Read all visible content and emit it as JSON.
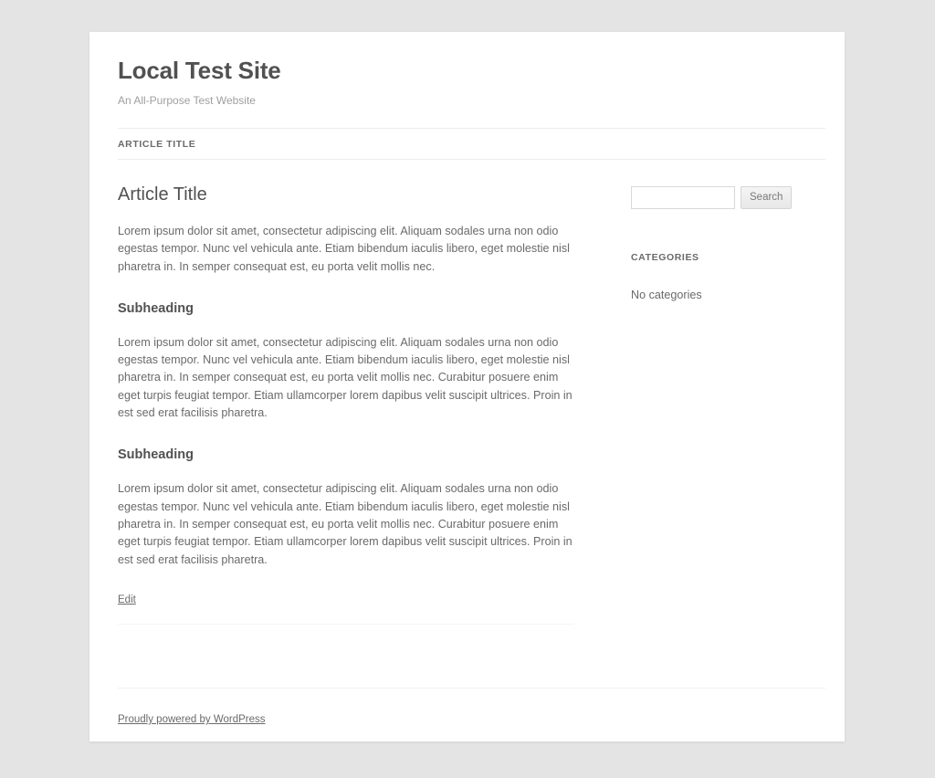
{
  "site": {
    "title": "Local Test Site",
    "description": "An All-Purpose Test Website"
  },
  "nav": {
    "items": [
      {
        "label": "Article Title"
      }
    ]
  },
  "article": {
    "title": "Article Title",
    "intro": "Lorem ipsum dolor sit amet, consectetur adipiscing elit. Aliquam sodales urna non odio egestas tempor. Nunc vel vehicula ante. Etiam bibendum iaculis libero, eget molestie nisl pharetra in. In semper consequat est, eu porta velit mollis nec.",
    "sections": [
      {
        "heading": "Subheading",
        "body": "Lorem ipsum dolor sit amet, consectetur adipiscing elit. Aliquam sodales urna non odio egestas tempor. Nunc vel vehicula ante. Etiam bibendum iaculis libero, eget molestie nisl pharetra in. In semper consequat est, eu porta velit mollis nec. Curabitur posuere enim eget turpis feugiat tempor. Etiam ullamcorper lorem dapibus velit suscipit ultrices. Proin in est sed erat facilisis pharetra."
      },
      {
        "heading": "Subheading",
        "body": "Lorem ipsum dolor sit amet, consectetur adipiscing elit. Aliquam sodales urna non odio egestas tempor. Nunc vel vehicula ante. Etiam bibendum iaculis libero, eget molestie nisl pharetra in. In semper consequat est, eu porta velit mollis nec. Curabitur posuere enim eget turpis feugiat tempor. Etiam ullamcorper lorem dapibus velit suscipit ultrices. Proin in est sed erat facilisis pharetra."
      }
    ],
    "edit_label": "Edit"
  },
  "sidebar": {
    "search": {
      "value": "",
      "placeholder": "",
      "button_label": "Search"
    },
    "categories_widget": {
      "title": "Categories",
      "empty_label": "No categories"
    }
  },
  "footer": {
    "credit_label": "Proudly powered by WordPress"
  },
  "colors": {
    "page_background": "#e4e4e4",
    "container_background": "#ffffff",
    "heading_text": "#515151",
    "body_text": "#6a6a6a",
    "muted_text": "#9f9f9f",
    "rule": "#ededed"
  }
}
